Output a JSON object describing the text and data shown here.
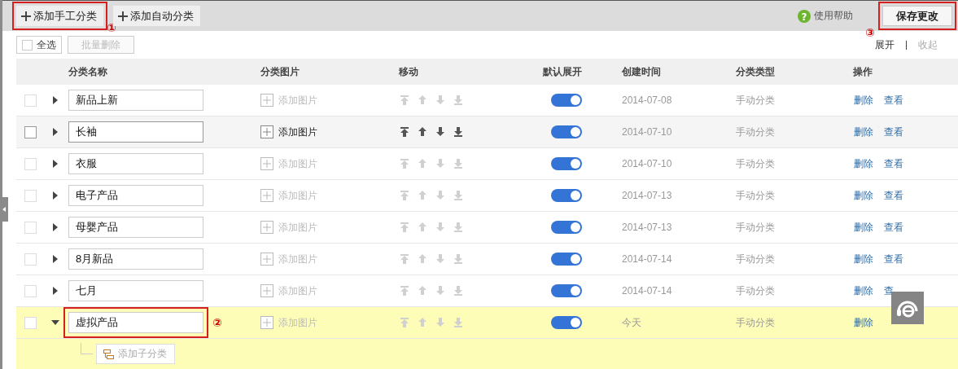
{
  "toolbar": {
    "buttons": [
      {
        "label": "添加手工分类",
        "callout": "①"
      },
      {
        "label": "添加自动分类"
      }
    ],
    "help_icon": "?",
    "help": "使用帮助",
    "save": {
      "label": "保存更改",
      "callout": "③"
    }
  },
  "bulk": {
    "select_all": {
      "label": "全选",
      "checked": false
    },
    "delete": {
      "label": "批量删除",
      "disabled": true
    }
  },
  "expand_links": [
    {
      "label": "展开",
      "disabled": false
    },
    {
      "label": "收起",
      "disabled": true
    }
  ],
  "table": {
    "columns": [
      "分类名称",
      "分类图片",
      "移动",
      "默认展开",
      "创建时间",
      "分类类型",
      "操作"
    ],
    "rows": [
      {
        "name": "新品上新",
        "checked": false,
        "expanded": false,
        "hovered": false,
        "selected": false,
        "image_label": "添加图片",
        "on": true,
        "created": "2014-07-08",
        "type": "手动分类",
        "actions": [
          "删除",
          "查看"
        ]
      },
      {
        "name": "长袖",
        "checked": false,
        "expanded": false,
        "hovered": true,
        "selected": false,
        "image_label": "添加图片",
        "on": true,
        "created": "2014-07-10",
        "type": "手动分类",
        "actions": [
          "删除",
          "查看"
        ]
      },
      {
        "name": "衣服",
        "checked": false,
        "expanded": false,
        "hovered": false,
        "selected": false,
        "image_label": "添加图片",
        "on": true,
        "created": "2014-07-10",
        "type": "手动分类",
        "actions": [
          "删除",
          "查看"
        ]
      },
      {
        "name": "电子产品",
        "checked": false,
        "expanded": false,
        "hovered": false,
        "selected": false,
        "image_label": "添加图片",
        "on": true,
        "created": "2014-07-13",
        "type": "手动分类",
        "actions": [
          "删除",
          "查看"
        ]
      },
      {
        "name": "母婴产品",
        "checked": false,
        "expanded": false,
        "hovered": false,
        "selected": false,
        "image_label": "添加图片",
        "on": true,
        "created": "2014-07-13",
        "type": "手动分类",
        "actions": [
          "删除",
          "查看"
        ]
      },
      {
        "name": "8月新品",
        "checked": false,
        "expanded": false,
        "hovered": false,
        "selected": false,
        "image_label": "添加图片",
        "on": true,
        "created": "2014-07-14",
        "type": "手动分类",
        "actions": [
          "删除",
          "查看"
        ]
      },
      {
        "name": "七月",
        "checked": false,
        "expanded": false,
        "hovered": false,
        "selected": false,
        "image_label": "添加图片",
        "on": true,
        "created": "2014-07-14",
        "type": "手动分类",
        "actions": [
          "删除",
          "查"
        ]
      },
      {
        "name": "虚拟产品",
        "name_callout": "②",
        "checked": false,
        "expanded": true,
        "hovered": false,
        "selected": true,
        "image_label": "添加图片",
        "on": true,
        "created": "今天",
        "type": "手动分类",
        "actions": [
          "删除"
        ],
        "add_child": "添加子分类"
      }
    ]
  }
}
